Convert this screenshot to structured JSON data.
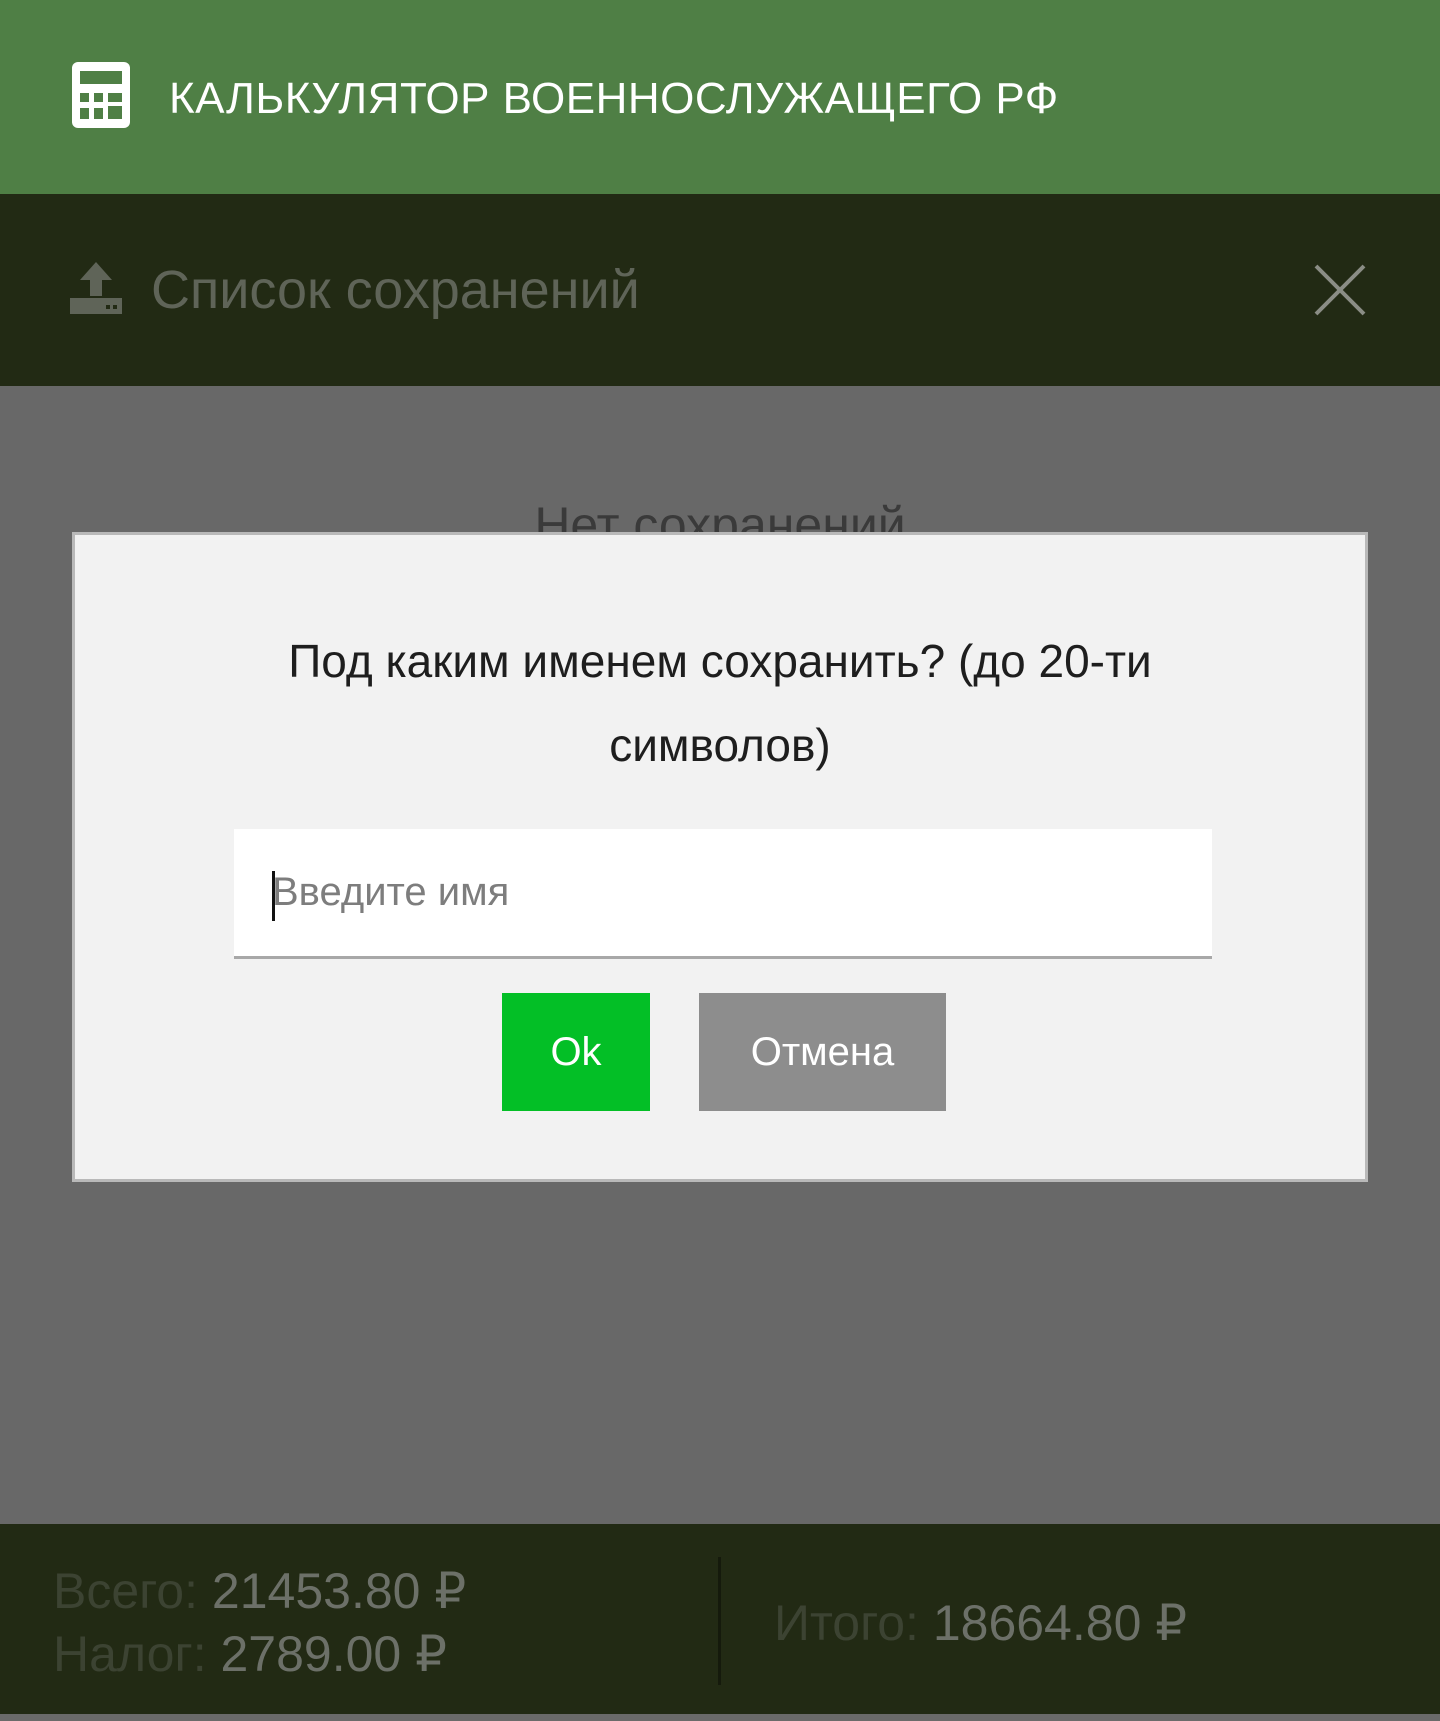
{
  "app_bar": {
    "title": "КАЛЬКУЛЯТОР ВОЕННОСЛУЖАЩЕГО РФ",
    "icon": "calculator-icon"
  },
  "panel": {
    "title": "Список сохранений",
    "icon": "upload-icon",
    "close_icon": "close-icon",
    "empty_text": "Нет сохранений"
  },
  "dialog": {
    "question": "Под каким именем сохранить? (до 20-ти символов)",
    "input_placeholder": "Введите имя",
    "input_value": "",
    "ok_label": "Ok",
    "cancel_label": "Отмена"
  },
  "footer": {
    "total_label": "Всего:",
    "total_value": "21453.80 ₽",
    "tax_label": "Налог:",
    "tax_value": "2789.00 ₽",
    "result_label": "Итого:",
    "result_value": "18664.80 ₽"
  },
  "colors": {
    "app_bar": "#4f7f45",
    "panel_header": "#222a14",
    "overlay": "#686868",
    "ok_button": "#03bf26",
    "cancel_button": "#8d8d8d"
  }
}
